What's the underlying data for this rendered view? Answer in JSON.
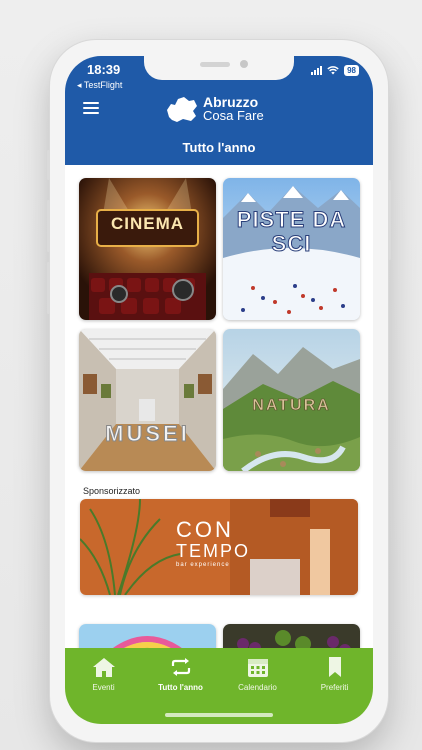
{
  "status_bar": {
    "time": "18:39",
    "back_app": "◂ TestFlight",
    "battery": "98"
  },
  "header": {
    "menu_icon": "hamburger-icon",
    "logo_line1": "Abruzzo",
    "logo_line2": "Cosa Fare",
    "page_title": "Tutto l'anno"
  },
  "tiles": [
    {
      "label": "CINEMA"
    },
    {
      "label": "PISTE DA SCI"
    },
    {
      "label": "MUSEI"
    },
    {
      "label": "NATURA"
    }
  ],
  "sponsored": {
    "label": "Sponsorizzato",
    "brand_line1": "CON",
    "brand_line2": "TEMPO",
    "brand_line3": "bar experience"
  },
  "tabbar": {
    "items": [
      {
        "label": "Eventi",
        "icon": "home-icon"
      },
      {
        "label": "Tutto l'anno",
        "icon": "repeat-icon"
      },
      {
        "label": "Calendario",
        "icon": "calendar-icon"
      },
      {
        "label": "Preferiti",
        "icon": "bookmark-icon"
      }
    ],
    "active": "Tutto l'anno"
  },
  "colors": {
    "header_blue": "#1f5aa8",
    "tabbar_green": "#6fb52b"
  }
}
